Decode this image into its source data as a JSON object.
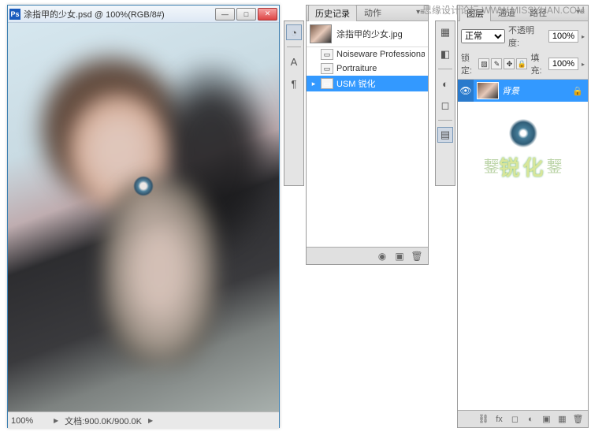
{
  "watermark": "思缘设计论坛  WWW.MISSYUAN.COM",
  "doc": {
    "icon": "Ps",
    "title": "涂指甲的少女.psd @ 100%(RGB/8#)",
    "zoom": "100%",
    "status": "文档:900.0K/900.0K"
  },
  "history": {
    "tabs": [
      "历史记录",
      "动作"
    ],
    "source": "涂指甲的少女.jpg",
    "items": [
      {
        "label": "Noiseware Professional"
      },
      {
        "label": "Portraiture"
      },
      {
        "label": "USM 锐化",
        "active": true
      }
    ]
  },
  "layers": {
    "tabs": [
      "图层",
      "通道",
      "路径"
    ],
    "blendMode": "正常",
    "opacityLabel": "不透明度:",
    "opacity": "100%",
    "lockLabel": "锁定:",
    "fillLabel": "填充:",
    "fill": "100%",
    "items": [
      {
        "name": "背景",
        "locked": true
      }
    ],
    "overlayText": "锐化"
  }
}
